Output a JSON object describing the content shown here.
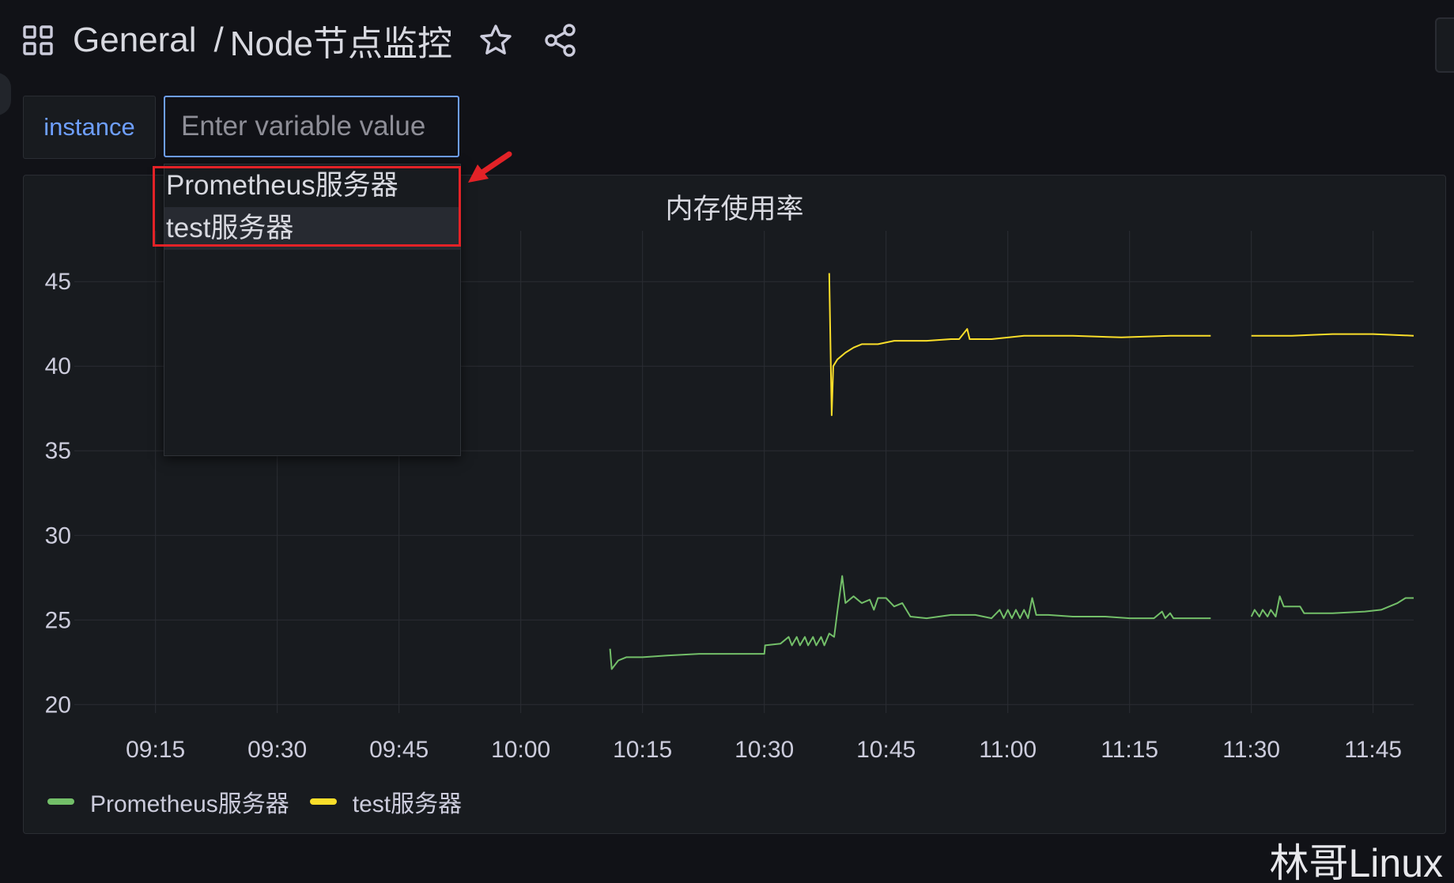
{
  "header": {
    "folder": "General",
    "separator": "/",
    "title": "Node节点监控"
  },
  "variable": {
    "label": "instance",
    "placeholder": "Enter variable value",
    "options": [
      "Prometheus服务器",
      "test服务器"
    ]
  },
  "panel": {
    "title": "内存使用率"
  },
  "watermark": "林哥Linux",
  "colors": {
    "background": "#111217",
    "panel": "#181b1f",
    "accent": "#6e9fff",
    "series_green": "#73bf69",
    "series_yellow": "#fade2a",
    "annotation_red": "#e32227"
  },
  "chart_data": {
    "type": "line",
    "title": "内存使用率",
    "x_ticks": [
      "09:15",
      "09:30",
      "09:45",
      "10:00",
      "10:15",
      "10:30",
      "10:45",
      "11:00",
      "11:15",
      "11:30",
      "11:45"
    ],
    "y_ticks": [
      20,
      25,
      30,
      35,
      40,
      45
    ],
    "xlim": [
      "09:05",
      "11:50"
    ],
    "ylim": [
      19.5,
      48
    ],
    "legend_position": "bottom-left",
    "grid": true,
    "series": [
      {
        "name": "Prometheus服务器",
        "color": "#73bf69",
        "segments": [
          [
            [
              "10:11",
              23.3
            ],
            [
              "10:11.2",
              22.1
            ],
            [
              "10:12",
              22.6
            ],
            [
              "10:13",
              22.8
            ],
            [
              "10:15",
              22.8
            ],
            [
              "10:18",
              22.9
            ],
            [
              "10:22",
              23.0
            ],
            [
              "10:26",
              23.0
            ],
            [
              "10:29",
              23.0
            ],
            [
              "10:30",
              23.0
            ],
            [
              "10:30.1",
              23.5
            ],
            [
              "10:32",
              23.6
            ],
            [
              "10:33",
              24.0
            ],
            [
              "10:33.4",
              23.5
            ],
            [
              "10:34",
              24.0
            ],
            [
              "10:34.4",
              23.5
            ],
            [
              "10:35",
              24.0
            ],
            [
              "10:35.4",
              23.5
            ],
            [
              "10:36",
              24.0
            ],
            [
              "10:36.4",
              23.5
            ],
            [
              "10:37",
              24.0
            ],
            [
              "10:37.4",
              23.5
            ],
            [
              "10:38",
              24.2
            ],
            [
              "10:38.6",
              24.0
            ],
            [
              "10:39",
              25.5
            ],
            [
              "10:39.6",
              27.6
            ],
            [
              "10:40",
              26.0
            ],
            [
              "10:41",
              26.4
            ],
            [
              "10:42",
              26.0
            ],
            [
              "10:43",
              26.2
            ],
            [
              "10:43.5",
              25.6
            ],
            [
              "10:44",
              26.3
            ],
            [
              "10:45",
              26.3
            ],
            [
              "10:46",
              25.8
            ],
            [
              "10:47",
              26.0
            ],
            [
              "10:48",
              25.2
            ],
            [
              "10:50",
              25.1
            ],
            [
              "10:53",
              25.3
            ],
            [
              "10:56",
              25.3
            ],
            [
              "10:58",
              25.1
            ],
            [
              "10:59",
              25.6
            ],
            [
              "10:59.5",
              25.1
            ],
            [
              "11:00",
              25.6
            ],
            [
              "11:00.5",
              25.1
            ],
            [
              "11:01",
              25.6
            ],
            [
              "11:01.5",
              25.1
            ],
            [
              "11:02",
              25.6
            ],
            [
              "11:02.5",
              25.1
            ],
            [
              "11:03",
              26.3
            ],
            [
              "11:03.5",
              25.3
            ],
            [
              "11:05",
              25.3
            ],
            [
              "11:08",
              25.2
            ],
            [
              "11:12",
              25.2
            ],
            [
              "11:15",
              25.1
            ],
            [
              "11:18",
              25.1
            ],
            [
              "11:19",
              25.5
            ],
            [
              "11:19.4",
              25.1
            ],
            [
              "11:20",
              25.4
            ],
            [
              "11:20.4",
              25.1
            ],
            [
              "11:25",
              25.1
            ]
          ],
          [
            [
              "11:30",
              25.2
            ],
            [
              "11:30.4",
              25.6
            ],
            [
              "11:31",
              25.2
            ],
            [
              "11:31.4",
              25.6
            ],
            [
              "11:32",
              25.2
            ],
            [
              "11:32.4",
              25.6
            ],
            [
              "11:33",
              25.2
            ],
            [
              "11:33.5",
              26.4
            ],
            [
              "11:34",
              25.8
            ],
            [
              "11:36",
              25.8
            ],
            [
              "11:36.5",
              25.4
            ],
            [
              "11:40",
              25.4
            ],
            [
              "11:44",
              25.5
            ],
            [
              "11:46",
              25.6
            ],
            [
              "11:48",
              26.0
            ],
            [
              "11:49",
              26.3
            ],
            [
              "11:50",
              26.3
            ]
          ]
        ]
      },
      {
        "name": "test服务器",
        "color": "#fade2a",
        "segments": [
          [
            [
              "10:38",
              45.5
            ],
            [
              "10:38.3",
              37.1
            ],
            [
              "10:38.5",
              40.0
            ],
            [
              "10:39",
              40.4
            ],
            [
              "10:40",
              40.8
            ],
            [
              "10:41",
              41.1
            ],
            [
              "10:42",
              41.3
            ],
            [
              "10:44",
              41.3
            ],
            [
              "10:46",
              41.5
            ],
            [
              "10:50",
              41.5
            ],
            [
              "10:53",
              41.6
            ],
            [
              "10:54",
              41.6
            ],
            [
              "10:55",
              42.2
            ],
            [
              "10:55.3",
              41.6
            ],
            [
              "10:58",
              41.6
            ],
            [
              "11:02",
              41.8
            ],
            [
              "11:08",
              41.8
            ],
            [
              "11:14",
              41.7
            ],
            [
              "11:20",
              41.8
            ],
            [
              "11:25",
              41.8
            ]
          ],
          [
            [
              "11:30",
              41.8
            ],
            [
              "11:35",
              41.8
            ],
            [
              "11:40",
              41.9
            ],
            [
              "11:45",
              41.9
            ],
            [
              "11:50",
              41.8
            ]
          ]
        ]
      }
    ]
  }
}
